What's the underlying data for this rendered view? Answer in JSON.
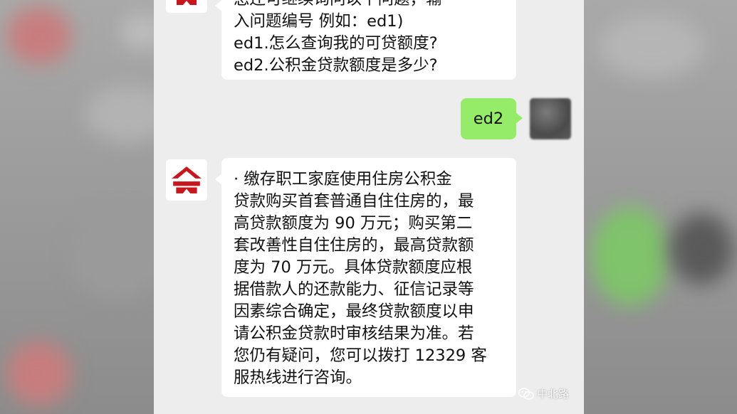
{
  "messages": {
    "first": {
      "lines": [
        "您还可继续询问以下问题，输",
        "入问题编号 例如：ed1)",
        "ed1.怎么查询我的可贷额度?",
        "ed2.公积金贷款额度是多少?"
      ]
    },
    "user_reply": {
      "text": "ed2"
    },
    "answer": {
      "lines": [
        "  · 缴存职工家庭使用住房公积金",
        "贷款购买首套普通自住住房的，最",
        "高贷款额度为 90 万元；购买第二",
        "套改善性自住住房的，最高贷款额",
        "度为 70 万元。具体贷款额度应根",
        "据借款人的还款能力、征信记录等",
        "因素综合确定，最终贷款额度以申",
        "请公积金贷款时审核结果为准。若",
        "您仍有疑问，您可以拨打 12329 客",
        "服热线进行咨询。"
      ]
    }
  },
  "watermark": {
    "text": "中北路",
    "icon": "wechat-icon"
  },
  "colors": {
    "bot_logo": "#c8161d",
    "user_bubble": "#95ec69",
    "chat_bg": "#ededed"
  }
}
